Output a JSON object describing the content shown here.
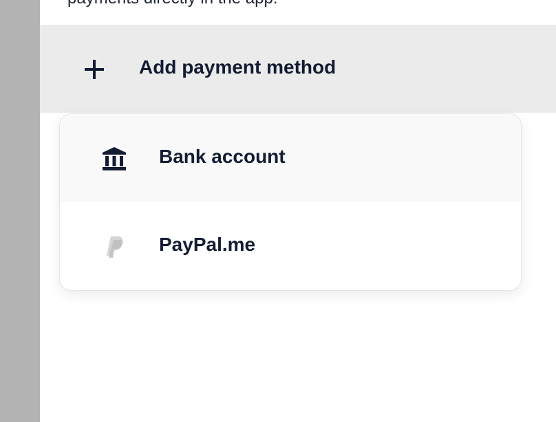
{
  "page": {
    "description_text": "payments directly in the app."
  },
  "add_payment": {
    "label": "Add payment method",
    "icon": "plus-icon"
  },
  "menu": {
    "items": [
      {
        "label": "Bank account",
        "icon": "bank-icon"
      },
      {
        "label": "PayPal.me",
        "icon": "paypal-icon"
      }
    ]
  },
  "colors": {
    "text_primary": "#131c33",
    "rail": "#b3b3b3",
    "add_row_bg": "#ebebeb",
    "paypal_icon": "#c9c9c9"
  }
}
